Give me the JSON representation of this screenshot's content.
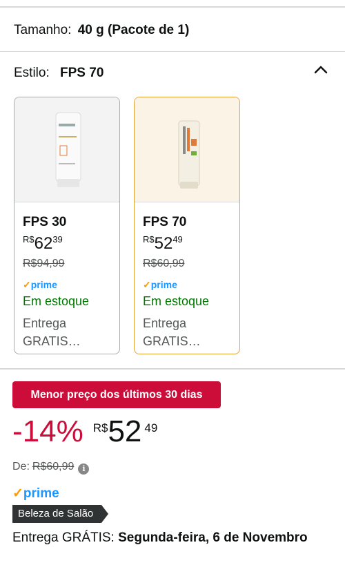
{
  "size": {
    "label": "Tamanho:",
    "value": "40 g (Pacote de 1)"
  },
  "style": {
    "label": "Estilo:",
    "value": "FPS 70"
  },
  "options": [
    {
      "name": "FPS 30",
      "price_currency": "R$",
      "price_whole": "62",
      "price_cents": "39",
      "was_price": "R$94,99",
      "prime": "prime",
      "stock": "Em estoque",
      "delivery_line1": "Entrega",
      "delivery_line2": "GRATIS…",
      "image_label": "MINESOL OIL CONTROL FPS 30"
    },
    {
      "name": "FPS 70",
      "price_currency": "R$",
      "price_whole": "52",
      "price_cents": "49",
      "was_price": "R$60,99",
      "prime": "prime",
      "stock": "Em estoque",
      "delivery_line1": "Entrega",
      "delivery_line2": "GRATIS…",
      "image_label": "NEOSTRATA MINESOL 70"
    }
  ],
  "deal": {
    "badge": "Menor preço dos últimos 30 dias",
    "discount": "-14%",
    "currency": "R$",
    "whole": "52",
    "cents": "49",
    "was_label": "De:",
    "was_price": "R$60,99"
  },
  "prime_label": "prime",
  "salon_badge": "Beleza de Salão",
  "delivery": {
    "prefix": "Entrega GRÁTIS:",
    "date": "Segunda-feira, 6 de Novembro"
  },
  "colors": {
    "deal_red": "#cc0c39",
    "prime_blue": "#1a98ff",
    "stock_green": "#007600",
    "selected_border": "#e3a33b"
  }
}
